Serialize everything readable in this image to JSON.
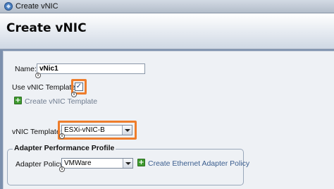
{
  "window": {
    "title": "Create vNIC"
  },
  "header": {
    "heading": "Create vNIC"
  },
  "form": {
    "name_label": "Name:",
    "name_value": "vNic1",
    "use_template_label": "Use vNIC Template:",
    "use_template_checked": true,
    "create_template_link": "Create vNIC Template",
    "vnic_template_label": "vNIC Template:",
    "vnic_template_value": "ESXi-vNIC-B",
    "adapter_section_title": "Adapter Performance Profile",
    "adapter_policy_label": "Adapter Policy:",
    "adapter_policy_value": "VMWare",
    "create_policy_link": "Create Ethernet Adapter Policy"
  },
  "colors": {
    "highlight": "#ee7d2c",
    "add_icon": "#3e9a2e",
    "link": "#3a5d8e"
  },
  "icons": [
    "app-icon",
    "info-icon",
    "add-icon",
    "chevron-down-icon",
    "checkmark-icon"
  ]
}
